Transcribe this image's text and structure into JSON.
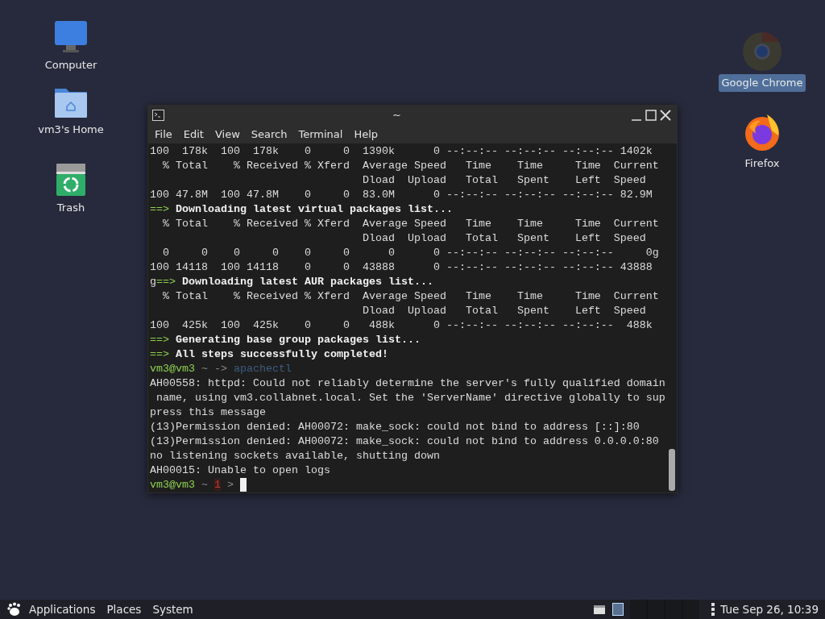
{
  "desktop_icons": [
    {
      "label": "Computer",
      "kind": "computer",
      "selected": false
    },
    {
      "label": "vm3's Home",
      "kind": "home",
      "selected": false
    },
    {
      "label": "Trash",
      "kind": "trash",
      "selected": false
    },
    {
      "label": "Google Chrome",
      "kind": "chrome",
      "selected": true
    },
    {
      "label": "Firefox",
      "kind": "firefox",
      "selected": false
    }
  ],
  "terminal": {
    "title": "~",
    "menu": [
      "File",
      "Edit",
      "View",
      "Search",
      "Terminal",
      "Help"
    ],
    "lines": [
      {
        "kind": "plain",
        "text": "100  178k  100  178k    0     0  1390k      0 --:--:-- --:--:-- --:--:-- 1402k"
      },
      {
        "kind": "plain",
        "text": "  % Total    % Received % Xferd  Average Speed   Time    Time     Time  Current"
      },
      {
        "kind": "plain",
        "text": "                                 Dload  Upload   Total   Spent    Left  Speed"
      },
      {
        "kind": "plain",
        "text": "100 47.8M  100 47.8M    0     0  83.0M      0 --:--:-- --:--:-- --:--:-- 82.9M"
      },
      {
        "kind": "step",
        "marker": "==>",
        "text": "Downloading latest virtual packages list..."
      },
      {
        "kind": "plain",
        "text": "  % Total    % Received % Xferd  Average Speed   Time    Time     Time  Current"
      },
      {
        "kind": "plain",
        "text": "                                 Dload  Upload   Total   Spent    Left  Speed"
      },
      {
        "kind": "plain",
        "text": "  0     0    0     0    0     0      0      0 --:--:-- --:--:-- --:--:--     0g"
      },
      {
        "kind": "plain",
        "text": "100 14118  100 14118    0     0  43888      0 --:--:-- --:--:-- --:--:-- 43888"
      },
      {
        "kind": "step",
        "lead": "g",
        "marker": "==>",
        "text": "Downloading latest AUR packages list..."
      },
      {
        "kind": "plain",
        "text": "  % Total    % Received % Xferd  Average Speed   Time    Time     Time  Current"
      },
      {
        "kind": "plain",
        "text": "                                 Dload  Upload   Total   Spent    Left  Speed"
      },
      {
        "kind": "plain",
        "text": "100  425k  100  425k    0     0   488k      0 --:--:-- --:--:-- --:--:--  488k"
      },
      {
        "kind": "step",
        "marker": "==>",
        "text": "Generating base group packages list..."
      },
      {
        "kind": "step",
        "marker": "==>",
        "text": "All steps successfully completed!"
      },
      {
        "kind": "prompt",
        "user": "vm3@vm3",
        "dir": "~",
        "arrow": "->",
        "command": "apachectl"
      },
      {
        "kind": "plain",
        "text": "AH00558: httpd: Could not reliably determine the server's fully qualified domain"
      },
      {
        "kind": "plain",
        "text": " name, using vm3.collabnet.local. Set the 'ServerName' directive globally to sup"
      },
      {
        "kind": "plain",
        "text": "press this message"
      },
      {
        "kind": "plain",
        "text": "(13)Permission denied: AH00072: make_sock: could not bind to address [::]:80"
      },
      {
        "kind": "plain",
        "text": "(13)Permission denied: AH00072: make_sock: could not bind to address 0.0.0.0:80"
      },
      {
        "kind": "plain",
        "text": "no listening sockets available, shutting down"
      },
      {
        "kind": "plain",
        "text": "AH00015: Unable to open logs"
      },
      {
        "kind": "prompt",
        "user": "vm3@vm3",
        "dir": "~",
        "status": "1",
        "arrow": ">",
        "cursor": true
      }
    ]
  },
  "taskbar": {
    "menus": [
      "Applications",
      "Places",
      "System"
    ],
    "clock": "Tue Sep 26, 10:39"
  }
}
